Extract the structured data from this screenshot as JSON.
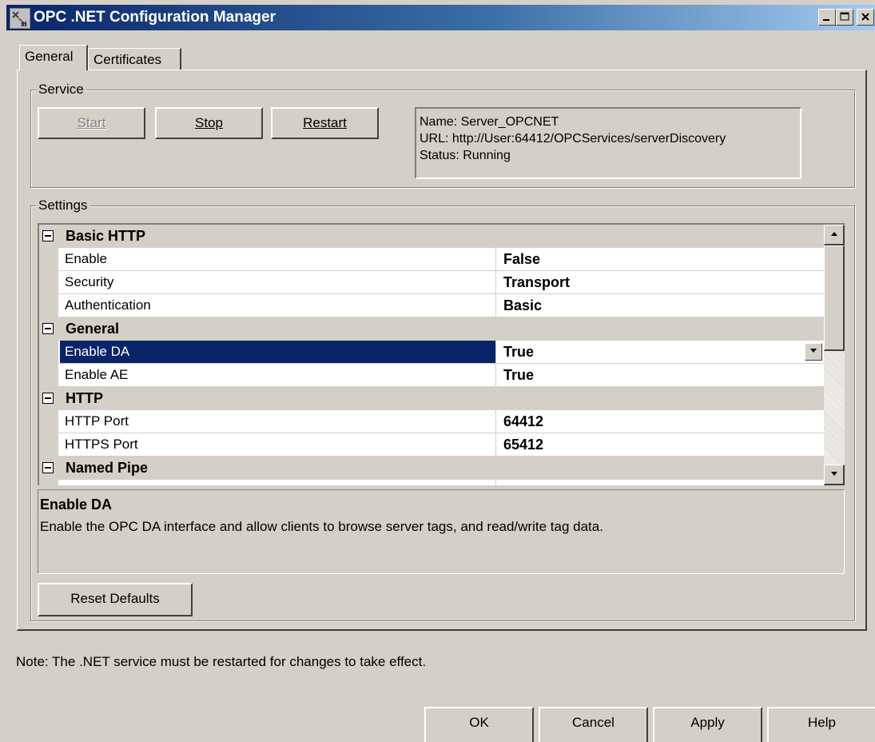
{
  "window": {
    "title": "OPC .NET Configuration Manager"
  },
  "tabs": [
    {
      "label": "General",
      "active": true
    },
    {
      "label": "Certificates",
      "active": false
    }
  ],
  "service": {
    "group_label": "Service",
    "start_label": "Start",
    "stop_label": "Stop",
    "restart_label": "Restart",
    "info": {
      "name_line": "Name: Server_OPCNET",
      "url_line": "URL: http://User:64412/OPCServices/serverDiscovery",
      "status_line": "Status: Running"
    }
  },
  "settings": {
    "group_label": "Settings",
    "categories": [
      {
        "name": "Basic HTTP",
        "properties": [
          {
            "name": "Enable",
            "value": "False"
          },
          {
            "name": "Security",
            "value": "Transport"
          },
          {
            "name": "Authentication",
            "value": "Basic"
          }
        ]
      },
      {
        "name": "General",
        "properties": [
          {
            "name": "Enable DA",
            "value": "True",
            "selected": true
          },
          {
            "name": "Enable AE",
            "value": "True"
          }
        ]
      },
      {
        "name": "HTTP",
        "properties": [
          {
            "name": "HTTP Port",
            "value": "64412"
          },
          {
            "name": "HTTPS Port",
            "value": "65412"
          }
        ]
      },
      {
        "name": "Named Pipe",
        "properties": []
      }
    ],
    "description": {
      "title": "Enable DA",
      "text": "Enable the OPC DA interface and allow clients to browse server tags, and read/write tag data."
    },
    "reset_label": "Reset Defaults"
  },
  "note": "Note: The .NET service must be restarted for changes to take effect.",
  "footer": {
    "ok_label": "OK",
    "cancel_label": "Cancel",
    "apply_label": "Apply",
    "help_label": "Help"
  },
  "colors": {
    "face": "#d4d0c8",
    "title_start": "#0a246a",
    "title_end": "#a6caf0",
    "selection": "#0a246a"
  }
}
